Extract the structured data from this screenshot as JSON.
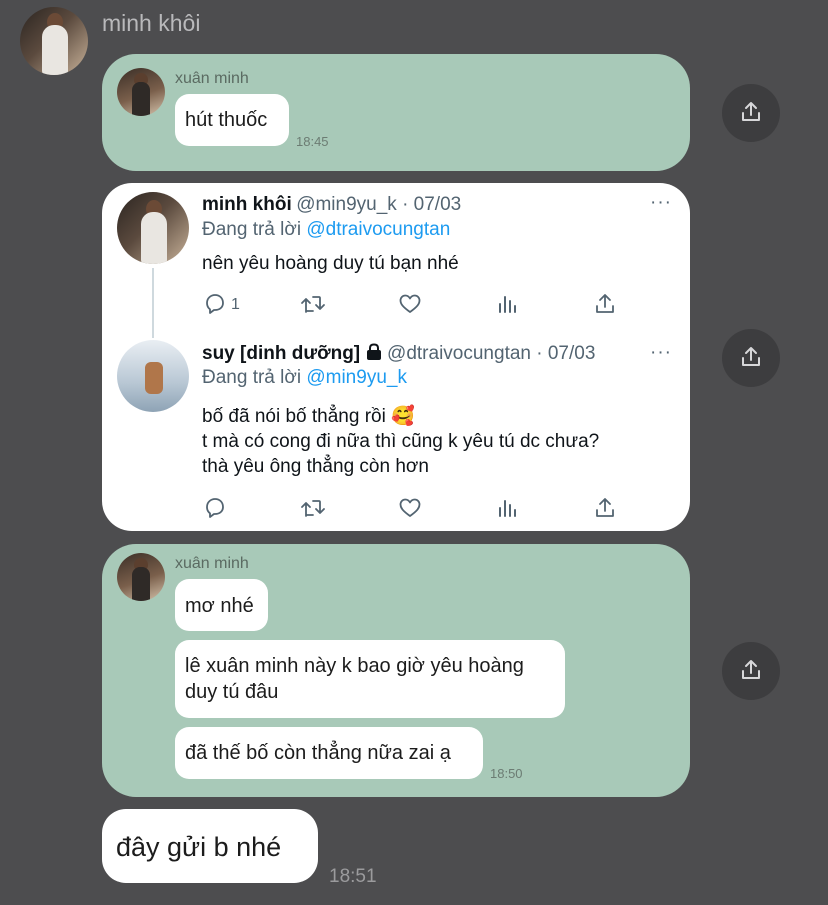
{
  "header": {
    "sender_name": "minh khôi"
  },
  "quote1": {
    "name": "xuân minh",
    "message": "hút thuốc",
    "time": "18:45"
  },
  "tweet1": {
    "name": "minh khôi",
    "meta": "@min9yu_k · 07/03",
    "reply_prefix": "Đang trả lời ",
    "reply_handle": "@dtraivocungtan",
    "body": "nên yêu hoàng duy tú bạn nhé",
    "reply_count": "1",
    "more": "···"
  },
  "tweet2": {
    "name": "suy [dinh dưỡng]",
    "meta": "@dtraivocungtan · 07/03",
    "reply_prefix": "Đang trả lời ",
    "reply_handle": "@min9yu_k",
    "body_lines": [
      "bố đã nói bố thẳng rồi 🥰",
      "t mà có cong đi nữa thì cũng k yêu tú dc chưa?",
      "thà yêu ông thẳng còn hơn"
    ],
    "more": "···"
  },
  "quote2": {
    "name": "xuân minh",
    "messages": [
      "mơ nhé",
      "lê xuân minh này k bao giờ yêu hoàng duy tú đâu",
      "đã thế bố còn thẳng nữa zai ạ"
    ],
    "time": "18:50"
  },
  "last_message": {
    "text": "đây gửi b nhé",
    "time": "18:51"
  },
  "colors": {
    "background": "#4d4d4f",
    "quote_bubble": "#a8c9b8",
    "link": "#1d9bf0"
  },
  "icons": [
    "share-icon",
    "reply-icon",
    "retweet-icon",
    "like-icon",
    "views-icon",
    "tweet-share-icon",
    "lock-icon",
    "more-icon"
  ]
}
